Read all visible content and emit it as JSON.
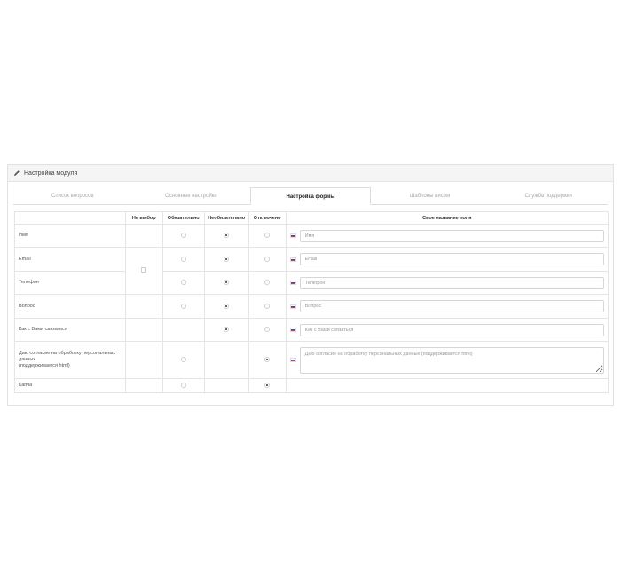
{
  "panel": {
    "title": "Настройка модуля",
    "icon": "pencil-icon"
  },
  "tabs": [
    {
      "label": "Список вопросов",
      "active": false
    },
    {
      "label": "Основные настройки",
      "active": false
    },
    {
      "label": "Настройка формы",
      "active": true
    },
    {
      "label": "Шаблоны писем",
      "active": false
    },
    {
      "label": "Служба поддержки",
      "active": false
    }
  ],
  "table": {
    "headers": {
      "field": "",
      "no_choice": "Не выбор",
      "required": "Обязательно",
      "optional": "Необязательно",
      "disabled": "Отключено",
      "custom_name": "Свое название поля"
    },
    "rows": [
      {
        "label": "Имя",
        "placeholder": "Имя",
        "selected": "optional"
      },
      {
        "label": "Email",
        "placeholder": "Email",
        "selected": "optional"
      },
      {
        "label": "Телефон",
        "placeholder": "Телефон",
        "selected": "optional"
      },
      {
        "label": "Вопрос",
        "placeholder": "Вопрос",
        "selected": "optional"
      },
      {
        "label": "Как с Вами связаться",
        "placeholder": "Как с Вами связаться",
        "selected": "optional"
      },
      {
        "label_lines": [
          "Даю согласие на обработку персональных",
          "данных",
          "(поддерживается html)"
        ],
        "placeholder": "Даю согласие на обработку персональных данных (поддерживается html)",
        "selected": "disabled"
      },
      {
        "label": "Капча",
        "selected": "disabled"
      }
    ]
  }
}
